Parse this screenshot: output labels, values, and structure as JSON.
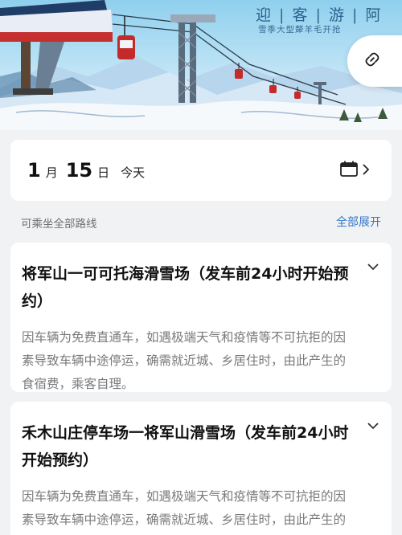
{
  "banner": {
    "title": "迎 | 客 | 游 | 阿",
    "subtitle": "雪季大型犛羊毛开抢",
    "share_icon": "link-icon",
    "colors": {
      "sky": "#9ed8f2",
      "snow": "#f4f8fc",
      "mountain": "#c9dff0",
      "cabin_red": "#c42a2a"
    }
  },
  "date_picker": {
    "month": "1",
    "month_unit": "月",
    "day": "15",
    "day_unit": "日",
    "relative": "今天",
    "icon": "calendar-icon"
  },
  "routes_section": {
    "label": "可乘坐全部路线",
    "expand_all": "全部展开",
    "accent": "#3777c6"
  },
  "routes": [
    {
      "title": "将军山一可可托海滑雪场（发车前24小时开始预约）",
      "description": "因车辆为免费直通车，如遇极端天气和疫情等不可抗拒的因素导致车辆中途停运，确需就近城、乡居住时，由此产生的食宿费，乘客自理。"
    },
    {
      "title": "禾木山庄停车场一将军山滑雪场（发车前24小时开始预约）",
      "description": "因车辆为免费直通车，如遇极端天气和疫情等不可抗拒的因素导致车辆中途停运，确需就近城、乡居住时，由此产生的食宿费，乘客自理。"
    }
  ]
}
